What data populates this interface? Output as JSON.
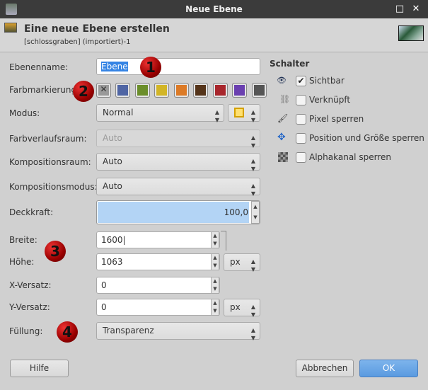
{
  "window": {
    "title": "Neue Ebene"
  },
  "header": {
    "title": "Eine neue Ebene erstellen",
    "subtitle": "[schlossgraben] (importiert)-1"
  },
  "form": {
    "name_label": "Ebenenname:",
    "name_value": "Ebene",
    "color_label": "Farbmarkierung",
    "color_tags": [
      "#4f65a4",
      "#6b8e2a",
      "#d2b526",
      "#dc7a26",
      "#55341a",
      "#a8262c",
      "#6a3fb0",
      "#555555"
    ],
    "mode_label": "Modus:",
    "mode_value": "Normal",
    "blend_space_label": "Farbverlaufsraum:",
    "blend_space_value": "Auto",
    "comp_space_label": "Kompositionsraum:",
    "comp_space_value": "Auto",
    "comp_mode_label": "Kompositionsmodus:",
    "comp_mode_value": "Auto",
    "opacity_label": "Deckkraft:",
    "opacity_value": "100,0",
    "opacity_percent": 100,
    "width_label": "Breite:",
    "width_value": "1600",
    "height_label": "Höhe:",
    "height_value": "1063",
    "size_unit": "px",
    "xoff_label": "X-Versatz:",
    "xoff_value": "0",
    "yoff_label": "Y-Versatz:",
    "yoff_value": "0",
    "offset_unit": "px",
    "fill_label": "Füllung:",
    "fill_value": "Transparenz"
  },
  "switches": {
    "title": "Schalter",
    "items": [
      {
        "label": "Sichtbar",
        "checked": true
      },
      {
        "label": "Verknüpft",
        "checked": false
      },
      {
        "label": "Pixel sperren",
        "checked": false
      },
      {
        "label": "Position und Größe sperren",
        "checked": false
      },
      {
        "label": "Alphakanal sperren",
        "checked": false
      }
    ]
  },
  "annotations": [
    "1",
    "2",
    "3",
    "4"
  ],
  "buttons": {
    "help": "Hilfe",
    "cancel": "Abbrechen",
    "ok": "OK"
  }
}
